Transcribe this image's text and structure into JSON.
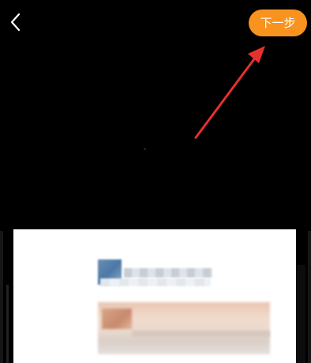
{
  "header": {
    "back_icon": "chevron-left-icon",
    "next_label": "下一步",
    "next_color": "#f7931e"
  },
  "annotation": {
    "arrow_color": "#e5312d"
  }
}
